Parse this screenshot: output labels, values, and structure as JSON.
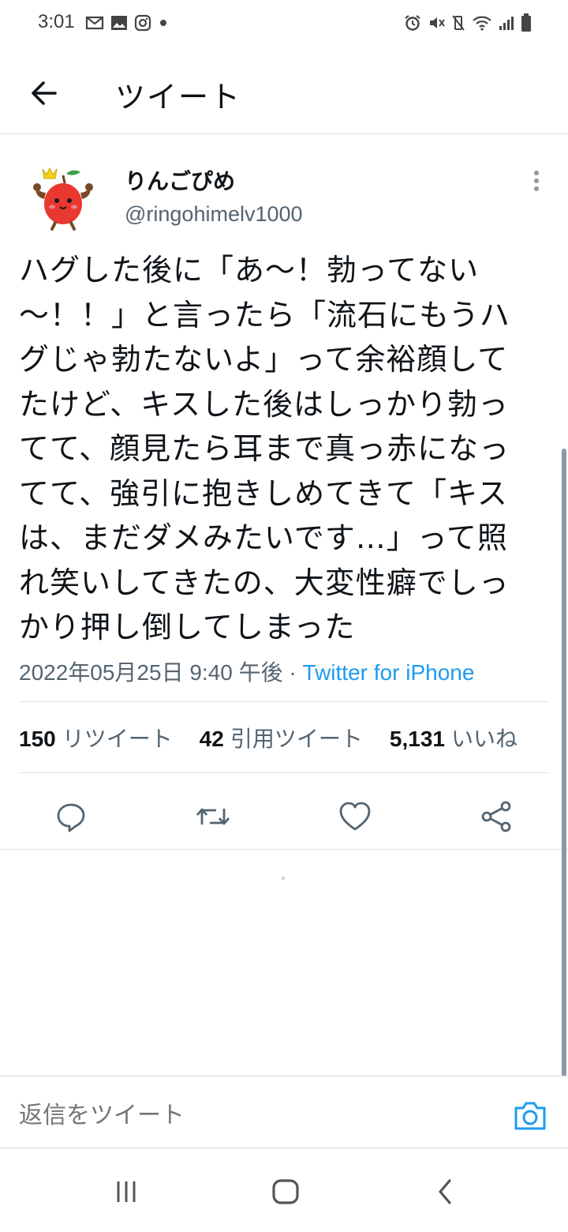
{
  "status_bar": {
    "time": "3:01",
    "left_icons": [
      "gmail-icon",
      "gallery-icon",
      "instagram-icon",
      "dot-icon"
    ],
    "right_icons": [
      "alarm-icon",
      "mute-icon",
      "vibrate-off-icon",
      "wifi-icon",
      "signal-icon",
      "battery-icon"
    ]
  },
  "header": {
    "back_icon": "back-arrow-icon",
    "title": "ツイート"
  },
  "tweet": {
    "display_name": "りんごぴめ",
    "handle": "@ringohimelv1000",
    "avatar": "apple-character-avatar",
    "text": "ハグした後に「あ〜！勃ってない\n〜！！」と言ったら「流石にもうハ\nグじゃ勃たないよ」って余裕顔して\nたけど、キスした後はしっかり勃っ\nてて、顔見たら耳まで真っ赤になっ\nてて、強引に抱きしめてきて「キス\nは、まだダメみたいです…」って照\nれ笑いしてきたの、大変性癖でしっ\nかり押し倒してしまった",
    "timestamp": "2022年05月25日 9:40 午後",
    "separator": " · ",
    "source": "Twitter for iPhone",
    "stats": {
      "retweets_count": "150",
      "retweets_label": "リツイート",
      "quotes_count": "42",
      "quotes_label": "引用ツイート",
      "likes_count": "5,131",
      "likes_label": "いいね"
    },
    "actions": [
      "reply-icon",
      "retweet-icon",
      "like-icon",
      "share-icon"
    ]
  },
  "reply_bar": {
    "placeholder": "返信をツイート",
    "camera_icon": "camera-icon"
  },
  "nav_bar": {
    "buttons": [
      "recent-apps-icon",
      "home-icon",
      "back-icon"
    ]
  },
  "colors": {
    "accent": "#1d9bf0",
    "text_primary": "#0f1419",
    "text_secondary": "#536471",
    "divider": "#dfe3e6",
    "avatar_apple": "#e8382f"
  }
}
